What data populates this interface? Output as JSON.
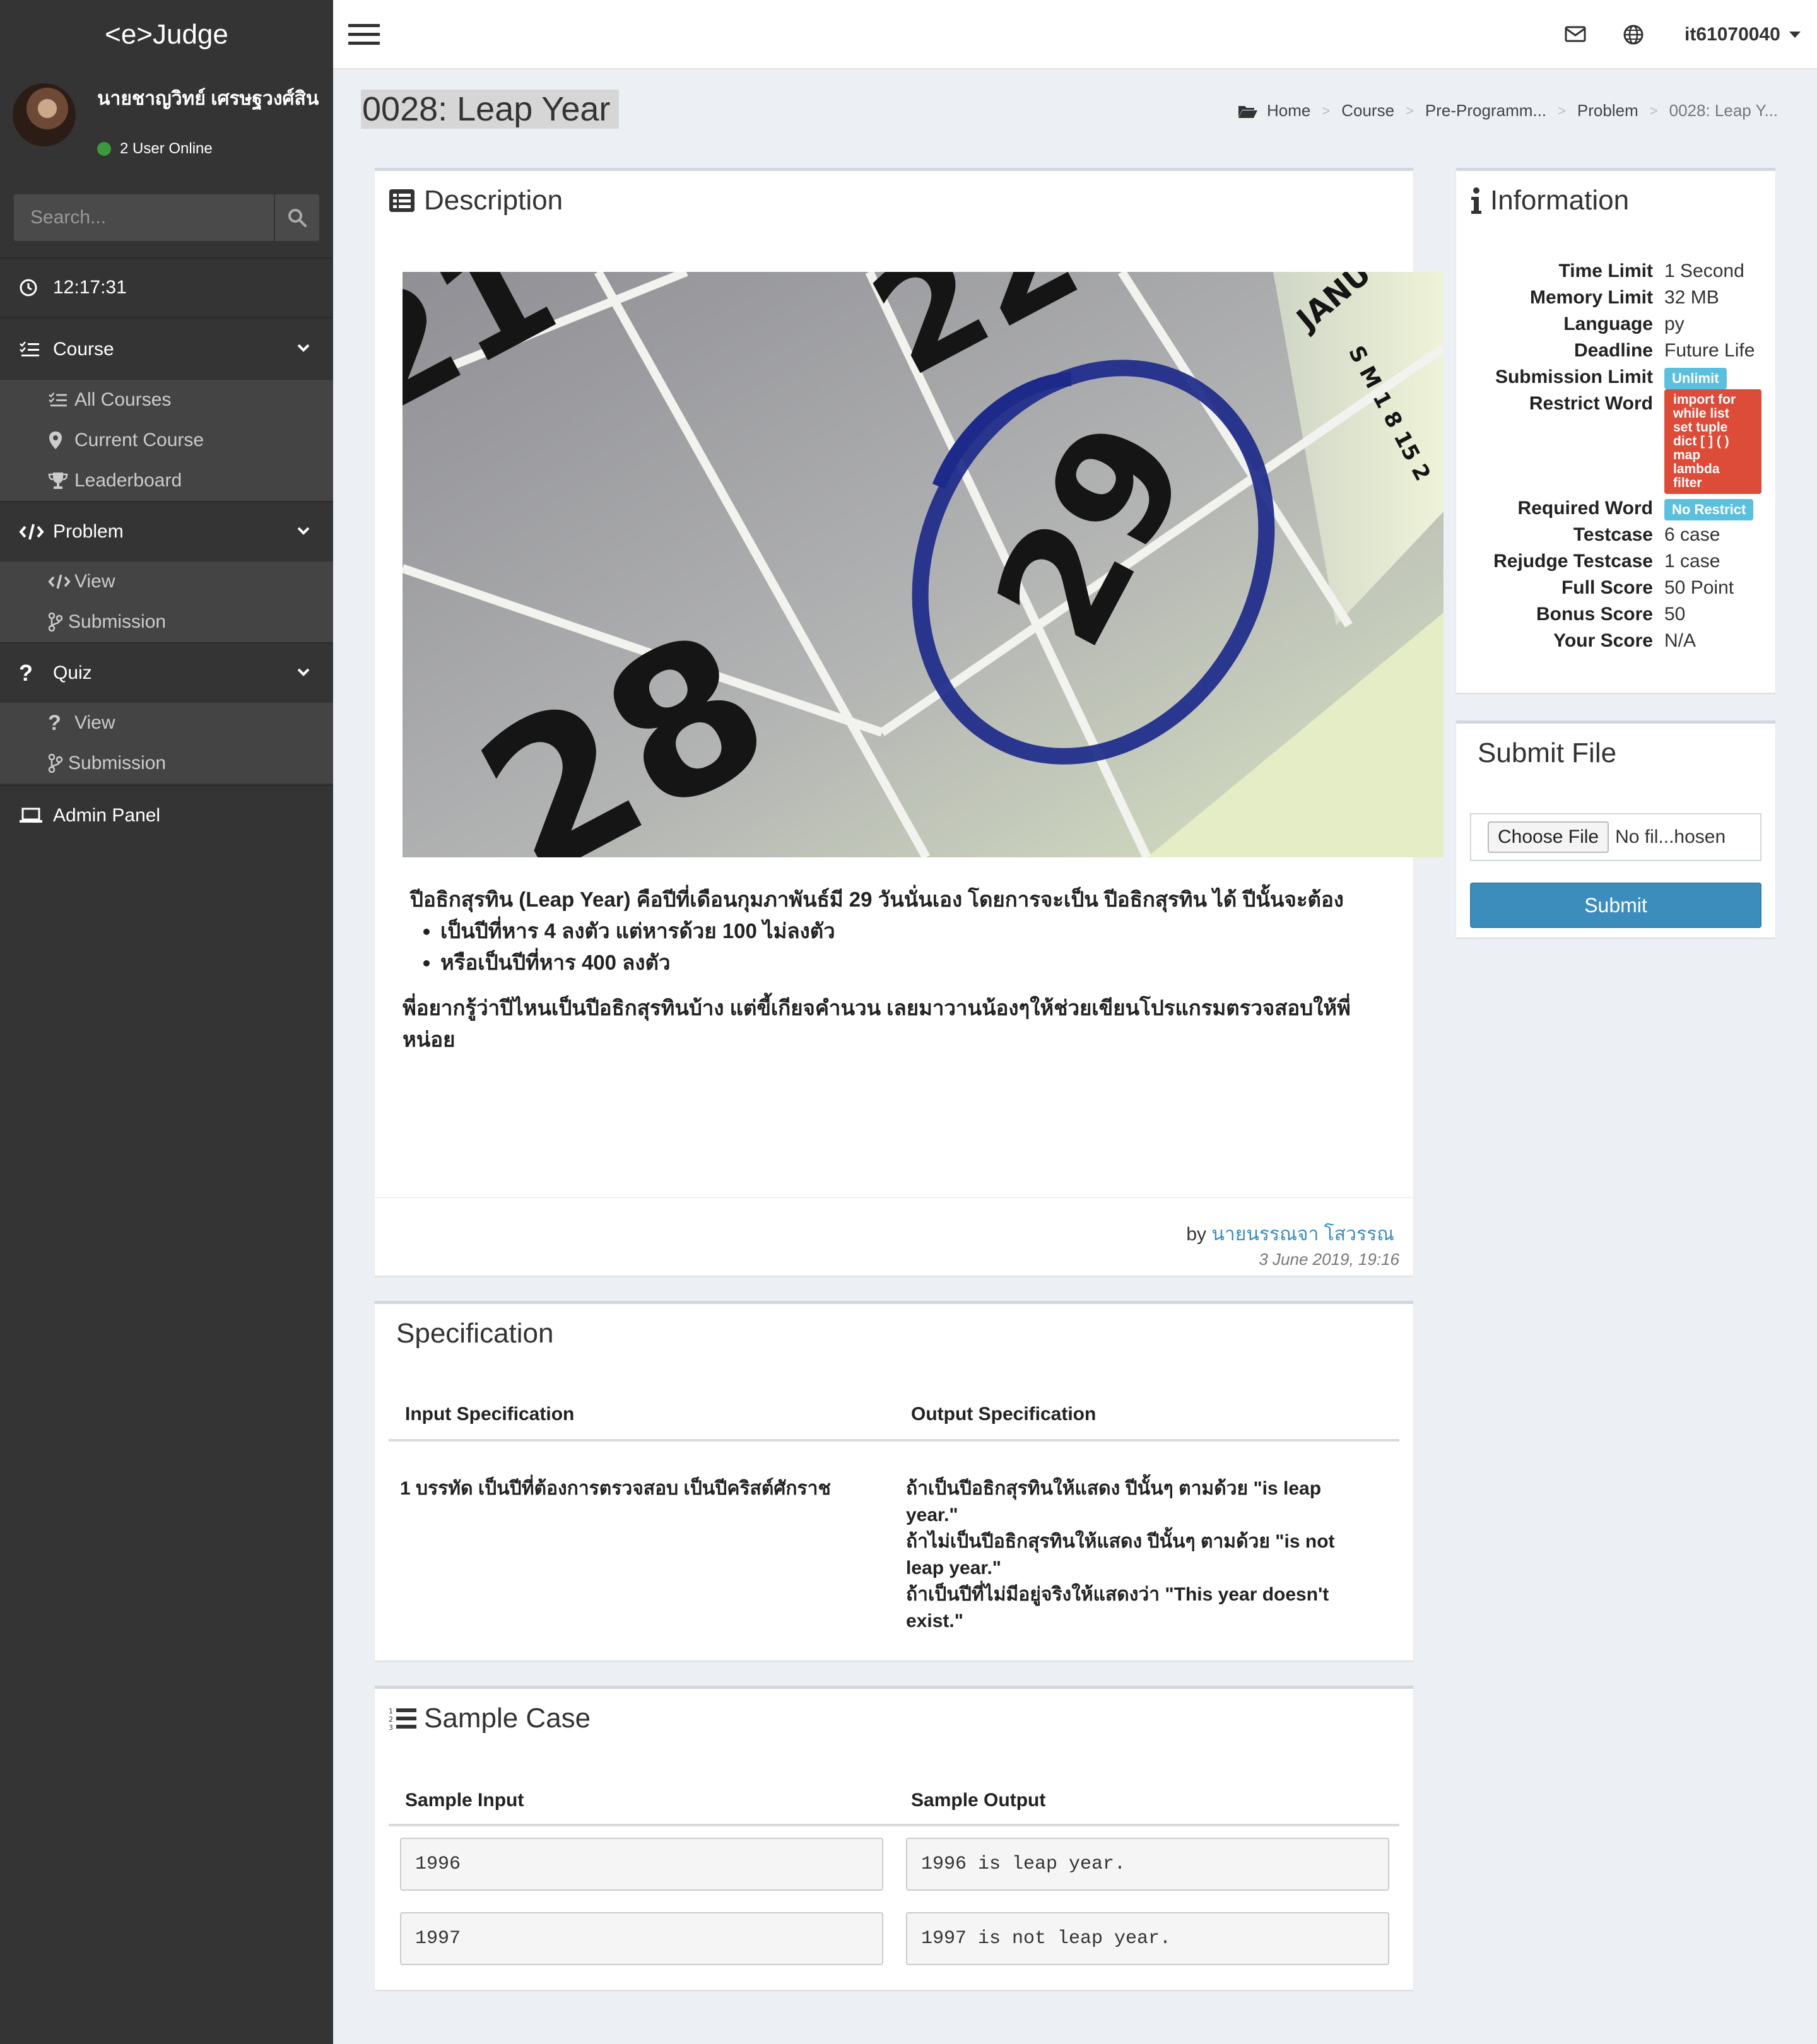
{
  "app": {
    "logo": "<e>Judge"
  },
  "user": {
    "name": "นายชาญวิทย์ เศรษฐวงศ์สิน",
    "online": "2 User Online",
    "username": "it61070040"
  },
  "search": {
    "placeholder": "Search..."
  },
  "clock": "12:17:31",
  "sidebar": {
    "course": {
      "label": "Course",
      "items": [
        "All Courses",
        "Current Course",
        "Leaderboard"
      ]
    },
    "problem": {
      "label": "Problem",
      "items": [
        "View",
        "Submission"
      ]
    },
    "quiz": {
      "label": "Quiz",
      "items": [
        "View",
        "Submission"
      ]
    },
    "admin": "Admin Panel"
  },
  "page": {
    "title": "0028: Leap Year",
    "breadcrumb": [
      "Home",
      "Course",
      "Pre-Programm...",
      "Problem",
      "0028: Leap Y..."
    ]
  },
  "description": {
    "title": "Description",
    "intro": "ปีอธิกสุรทิน (Leap Year) คือปีที่เดือนกุมภาพันธ์มี 29 วันนั่นเอง โดยการจะเป็น ปีอธิกสุรทิน ได้ ปีนั้นจะต้อง",
    "bullets": [
      "เป็นปีที่หาร 4 ลงตัว แต่หารด้วย 100 ไม่ลงตัว",
      "หรือเป็นปีที่หาร 400 ลงตัว"
    ],
    "outro": "พี่อยากรู้ว่าปีไหนเป็นปีอธิกสุรทินบ้าง แต่ขี้เกียจคำนวน เลยมาวานน้องๆให้ช่วยเขียนโปรแกรมตรวจสอบให้พี่หน่อย",
    "by": "by",
    "author": "นายนรรณจา โสวรรณ",
    "date": "3 June 2019, 19:16",
    "image": {
      "numbers": [
        "21",
        "22",
        "28",
        "29"
      ],
      "month": "JANU",
      "side_letters": "S M 1 8 15 2"
    }
  },
  "information": {
    "title": "Information",
    "rows": [
      {
        "label": "Time Limit",
        "value": "1 Second"
      },
      {
        "label": "Memory Limit",
        "value": "32 MB"
      },
      {
        "label": "Language",
        "value": "py"
      },
      {
        "label": "Deadline",
        "value": "Future Life"
      },
      {
        "label": "Submission Limit",
        "value": "Unlimit"
      },
      {
        "label": "Restrict Word",
        "value": "import for while list set tuple dict [ ] ( ) map lambda filter",
        "lines": [
          "import for",
          "while list",
          "set tuple",
          "dict [ ] ( )",
          "map",
          "lambda",
          "filter"
        ]
      },
      {
        "label": "Required Word",
        "value": "No Restrict"
      },
      {
        "label": "Testcase",
        "value": "6 case"
      },
      {
        "label": "Rejudge Testcase",
        "value": "1 case"
      },
      {
        "label": "Full Score",
        "value": "50 Point"
      },
      {
        "label": "Bonus Score",
        "value": "50"
      },
      {
        "label": "Your Score",
        "value": "N/A"
      }
    ]
  },
  "submit_file": {
    "title": "Submit File",
    "choose": "Choose File",
    "no_file": "No fil...hosen",
    "submit": "Submit"
  },
  "specification": {
    "title": "Specification",
    "input_header": "Input Specification",
    "output_header": "Output Specification",
    "input": "1 บรรทัด เป็นปีที่ต้องการตรวจสอบ เป็นปีคริสต์ศักราช",
    "output_lines": [
      "ถ้าเป็นปีอธิกสุรทินให้แสดง ปีนั้นๆ ตามด้วย \"is leap",
      "year.\"",
      "ถ้าไม่เป็นปีอธิกสุรทินให้แสดง ปีนั้นๆ ตามด้วย \"is not",
      "leap year.\"",
      "ถ้าเป็นปีที่ไม่มีอยู่จริงให้แสดงว่า \"This year doesn't",
      "exist.\""
    ]
  },
  "sample": {
    "title": "Sample Case",
    "input_header": "Sample Input",
    "output_header": "Sample Output",
    "rows": [
      {
        "input": "1996",
        "output": "1996 is leap year."
      },
      {
        "input": "1997",
        "output": "1997 is not leap year."
      }
    ]
  },
  "colors": {
    "sidebar": "#343434",
    "accent": "#3c8dbc",
    "info_label": "#5bc0de",
    "danger_label": "#dd4b39"
  }
}
